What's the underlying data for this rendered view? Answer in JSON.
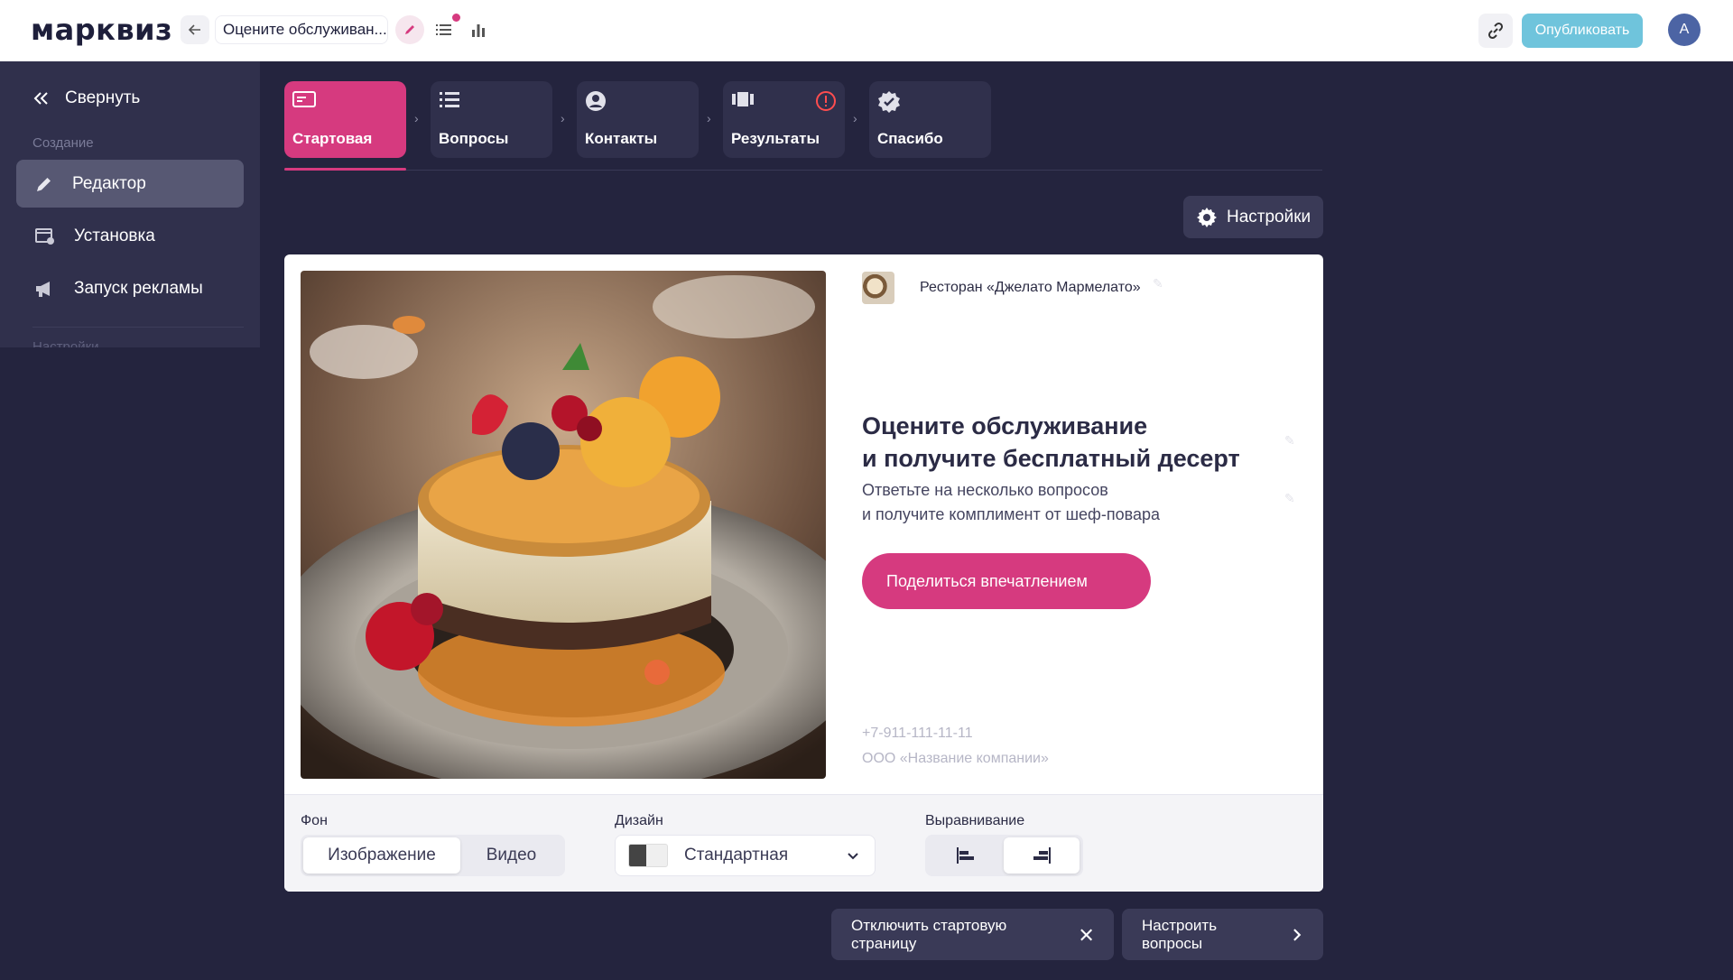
{
  "app": {
    "logo": "марквиз",
    "quiz_title": "Оцените обслуживан...",
    "publish_label": "Опубликовать",
    "avatar_initial": "А"
  },
  "sidebar": {
    "collapse_label": "Свернуть",
    "section_create": "Создание",
    "items": [
      {
        "label": "Редактор",
        "icon": "pencil-icon",
        "active": true
      },
      {
        "label": "Установка",
        "icon": "install-icon",
        "active": false
      },
      {
        "label": "Запуск рекламы",
        "icon": "megaphone-icon",
        "active": false
      }
    ],
    "section_settings": "Настройки"
  },
  "steps": [
    {
      "label": "Стартовая",
      "icon": "start-page-icon",
      "active": true
    },
    {
      "label": "Вопросы",
      "icon": "list-icon",
      "active": false
    },
    {
      "label": "Контакты",
      "icon": "user-icon",
      "active": false
    },
    {
      "label": "Результаты",
      "icon": "results-icon",
      "active": false,
      "warning": true
    },
    {
      "label": "Спасибо",
      "icon": "check-badge-icon",
      "active": false
    }
  ],
  "settings_label": "Настройки",
  "preview": {
    "brand_name": "Ресторан «Джелато Мармелато»",
    "headline_line1": "Оцените обслуживание",
    "headline_line2": "и получите бесплатный десерт",
    "sub_line1": "Ответьте на несколько вопросов",
    "sub_line2": "и получите комплимент от шеф-повара",
    "cta_label": "Поделиться впечатлением",
    "phone": "+7-911-111-11-11",
    "company": "ООО «Название компании»"
  },
  "footer": {
    "bg_label": "Фон",
    "bg_options": [
      "Изображение",
      "Видео"
    ],
    "bg_selected": "Изображение",
    "design_label": "Дизайн",
    "design_value": "Стандартная",
    "align_label": "Выравнивание",
    "align_selected": "right"
  },
  "bottom": {
    "disable_label": "Отключить стартовую страницу",
    "next_label": "Настроить вопросы"
  },
  "colors": {
    "accent": "#d63a7f",
    "publish": "#6fc4dc",
    "background": "#24243e",
    "panel": "#30304c"
  }
}
